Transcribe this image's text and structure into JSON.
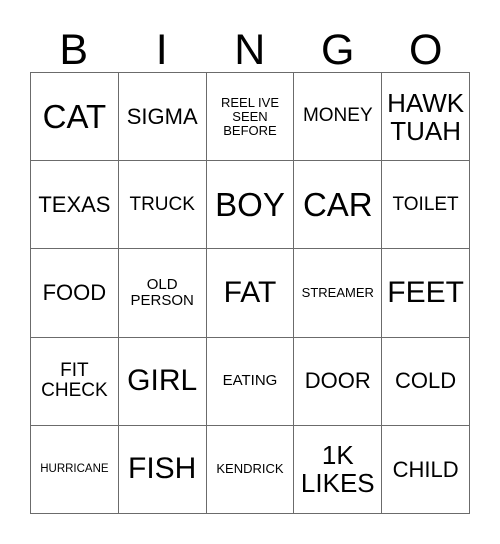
{
  "card": {
    "header_letters": [
      "B",
      "I",
      "N",
      "G",
      "O"
    ],
    "background_color": "#ffffff",
    "text_color": "#000000",
    "border_color": "#6b6b6b",
    "columns": 5,
    "rows": 5
  },
  "cells": [
    {
      "text": "CAT",
      "size": "sz-xxl"
    },
    {
      "text": "SIGMA",
      "size": "sz-md"
    },
    {
      "text": "REEL IVE SEEN BEFORE",
      "size": "sz-xxs"
    },
    {
      "text": "MONEY",
      "size": "sz-sm"
    },
    {
      "text": "HAWK TUAH",
      "size": "sz-lg"
    },
    {
      "text": "TEXAS",
      "size": "sz-md"
    },
    {
      "text": "TRUCK",
      "size": "sz-sm"
    },
    {
      "text": "BOY",
      "size": "sz-xxl"
    },
    {
      "text": "CAR",
      "size": "sz-xxl"
    },
    {
      "text": "TOILET",
      "size": "sz-sm"
    },
    {
      "text": "FOOD",
      "size": "sz-md"
    },
    {
      "text": "OLD PERSON",
      "size": "sz-xs"
    },
    {
      "text": "FAT",
      "size": "sz-xl"
    },
    {
      "text": "STREAMER",
      "size": "sz-xxs"
    },
    {
      "text": "FEET",
      "size": "sz-xl"
    },
    {
      "text": "FIT CHECK",
      "size": "sz-sm"
    },
    {
      "text": "GIRL",
      "size": "sz-xl"
    },
    {
      "text": "EATING",
      "size": "sz-xs"
    },
    {
      "text": "DOOR",
      "size": "sz-md"
    },
    {
      "text": "COLD",
      "size": "sz-md"
    },
    {
      "text": "HURRICANE",
      "size": "sz-tiny"
    },
    {
      "text": "FISH",
      "size": "sz-xl"
    },
    {
      "text": "KENDRICK",
      "size": "sz-xxs"
    },
    {
      "text": "1K LIKES",
      "size": "sz-lg"
    },
    {
      "text": "CHILD",
      "size": "sz-md"
    }
  ]
}
